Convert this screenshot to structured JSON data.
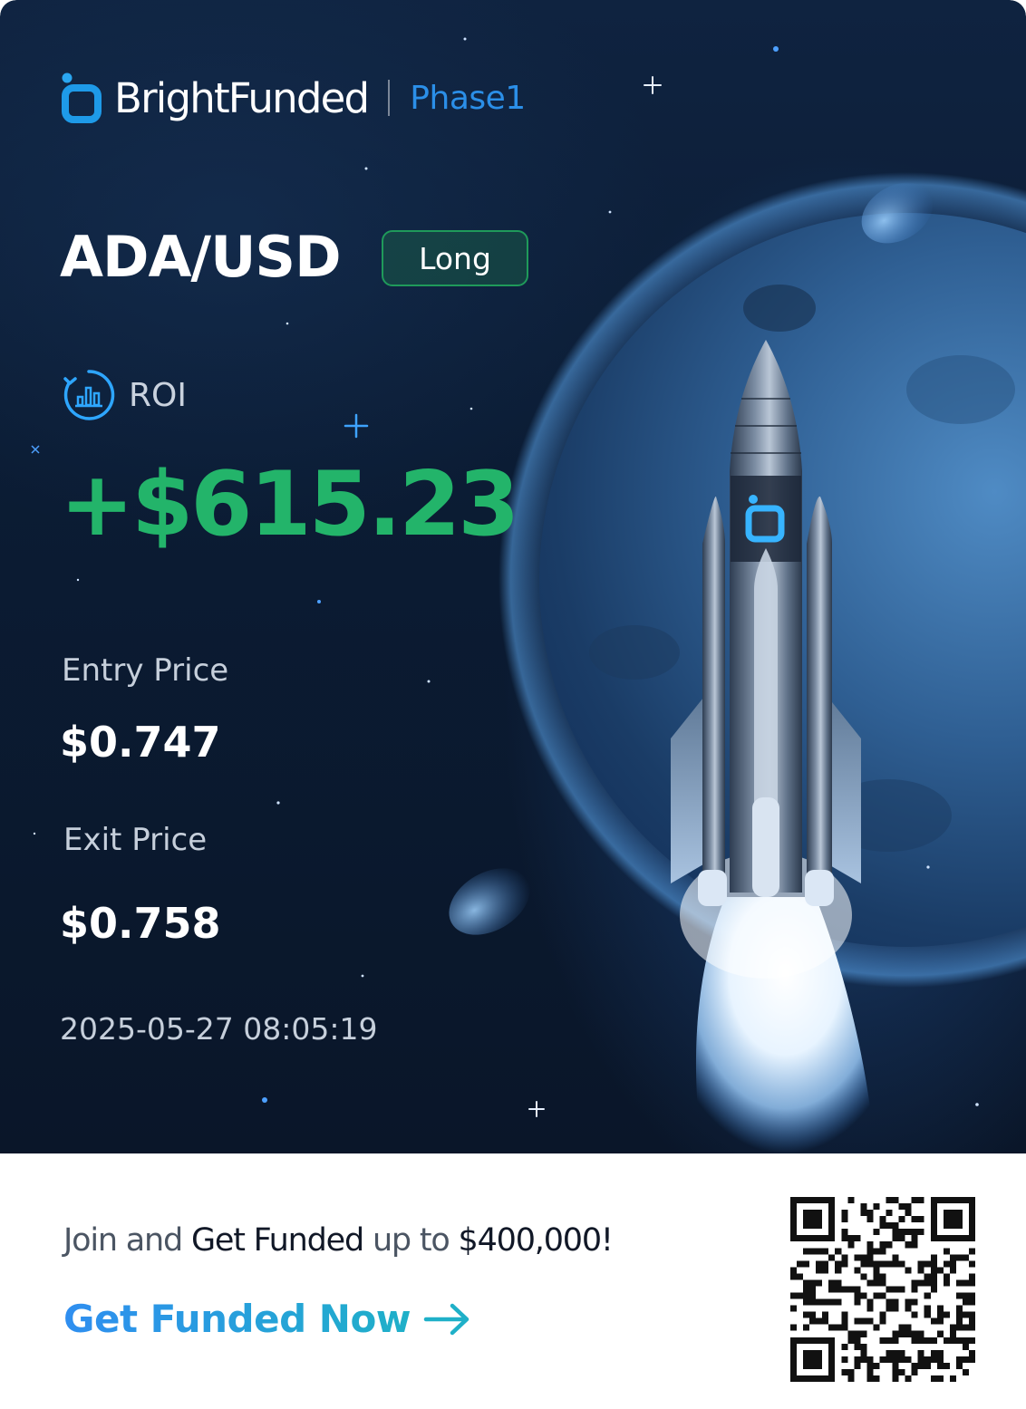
{
  "brand": {
    "name": "BrightFunded",
    "phase": "Phase1"
  },
  "trade": {
    "pair": "ADA/USD",
    "side": "Long",
    "roi_label": "ROI",
    "pnl": "+$615.23",
    "entry_label": "Entry Price",
    "entry_value": "$0.747",
    "exit_label": "Exit Price",
    "exit_value": "$0.758",
    "timestamp": "2025-05-27 08:05:19"
  },
  "promo": {
    "part1": "Join and ",
    "part2": "Get Funded",
    "part3": " up to ",
    "part4": "$400,000!"
  },
  "cta": {
    "label": "Get Funded Now"
  },
  "colors": {
    "accent_blue": "#2b8fe8",
    "profit_green": "#23b46a",
    "badge_green": "#1f9a5a",
    "background_dark": "#0b1c34"
  },
  "icons": {
    "brand": "brightfunded-logo-icon",
    "roi": "roi-chart-icon",
    "cta": "arrow-right-icon",
    "qr": "qr-code"
  }
}
